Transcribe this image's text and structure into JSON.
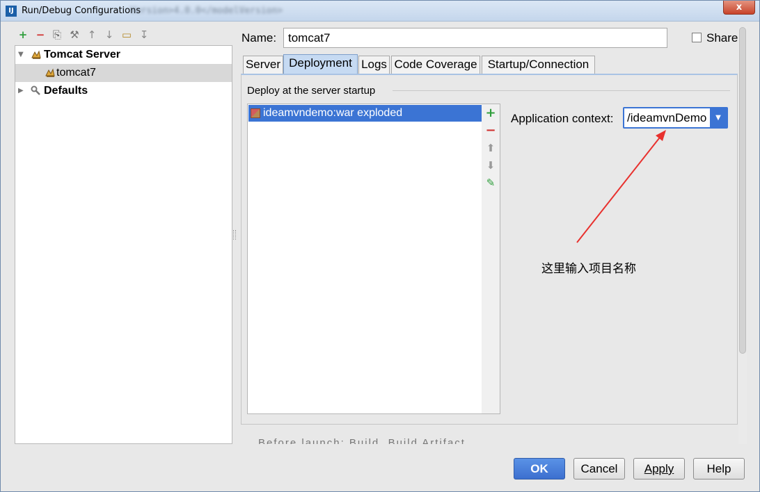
{
  "window": {
    "title": "Run/Debug Configurations",
    "title_blurred": "Version>4.0.0</modelVersion>",
    "close_label": "x",
    "app_icon_text": "IJ"
  },
  "toolbar": {
    "icons": [
      "add-icon",
      "remove-icon",
      "copy-icon",
      "edit-defaults-icon",
      "move-up-icon",
      "move-down-icon",
      "folder-icon",
      "sort-icon"
    ],
    "glyphs": [
      "+",
      "−",
      "⎘",
      "⚒",
      "↑",
      "↓",
      "▭",
      "↧"
    ]
  },
  "tree": {
    "items": [
      {
        "label": "Tomcat Server",
        "bold": true,
        "expanded": true
      },
      {
        "label": "tomcat7",
        "selected": true
      },
      {
        "label": "Defaults",
        "bold": true,
        "expanded": false
      }
    ],
    "arrows": {
      "expanded": "▼",
      "collapsed": "▶"
    }
  },
  "form": {
    "name_label": "Name:",
    "name_value": "tomcat7",
    "share_label": "Share",
    "share_checked": false
  },
  "tabs": [
    {
      "label": "Server"
    },
    {
      "label": "Deployment",
      "active": true
    },
    {
      "label": "Logs"
    },
    {
      "label": "Code Coverage"
    },
    {
      "label": "Startup/Connection"
    }
  ],
  "deployment": {
    "group_title": "Deploy at the server startup",
    "artifacts": [
      "ideamvndemo:war exploded"
    ],
    "side_actions": [
      {
        "name": "add-icon",
        "glyph": "+",
        "color": "#2f9e3c"
      },
      {
        "name": "remove-icon",
        "glyph": "−",
        "color": "#d0302f"
      },
      {
        "name": "move-up-icon",
        "glyph": "⬆",
        "color": "#9a9a9a"
      },
      {
        "name": "move-down-icon",
        "glyph": "⬇",
        "color": "#9a9a9a"
      },
      {
        "name": "edit-icon",
        "glyph": "✎",
        "color": "#2f9e3c"
      }
    ],
    "context_label": "Application context:",
    "context_value": "/ideamvnDemo",
    "dropdown_glyph": "▼"
  },
  "annotation": {
    "text": "这里输入项目名称",
    "color": "#e8312e"
  },
  "footer": {
    "cut_text": "Before launch: Build, Build Artifact",
    "buttons": {
      "ok": "OK",
      "cancel": "Cancel",
      "apply": "Apply",
      "help": "Help"
    }
  },
  "colors": {
    "accent": "#3b74d4",
    "selection": "#3b74d4",
    "tab_active": "#c6daf2"
  }
}
